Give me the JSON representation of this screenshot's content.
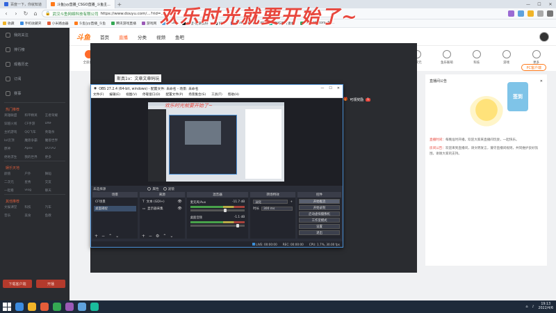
{
  "overlay_title": "欢乐时光就要开始了~",
  "browser": {
    "tabs": [
      {
        "label": "百度一下，你就知道",
        "color": "#3366dd",
        "active": false
      },
      {
        "label": "斗鱼|yy直播_CSGO直播_斗鱼主...",
        "color": "#ff7a1a",
        "active": true
      }
    ],
    "new_tab": "+",
    "url_site": "武汉斗鱼网络科技有限公司",
    "url": "https://www.douyu.com/...?rid=...",
    "bookmarks": [
      "收藏",
      "手机收藏夹",
      "小米路由器",
      "斗鱼|yy直播_斗鱼",
      "腾讯游戏直播",
      "游戏网",
      "CSGO",
      "抖音-记录美好",
      "抖音",
      "Free Transparent",
      "PNG图片素材",
      "Free Vectors, St..."
    ]
  },
  "douyu": {
    "logo": "斗鱼",
    "nav": [
      "首页",
      "直播",
      "分类",
      "视频",
      "鱼吧"
    ],
    "sidebar_top": [
      "我的关注",
      "排行榜",
      "观看历史",
      "订阅",
      "赛事"
    ],
    "sidebar_section1": "热门推荐",
    "sidebar_grid1": [
      "英雄联盟",
      "和平精英",
      "王者荣耀",
      "穿越火线",
      "CF手游",
      "DNF",
      "主机游戏",
      "QQ飞车",
      "英雄杀",
      "lol云顶",
      "魔兽争霸",
      "魔兽世界",
      "原神",
      "Apex",
      "DOTA2",
      "绝地求生",
      "我的世界",
      "更多"
    ],
    "sidebar_section2": "娱乐天地",
    "sidebar_grid2": [
      "颜值",
      "户外",
      "舞蹈",
      "二次元",
      "星秀",
      "交友",
      "一起看",
      "vlog",
      "聊天"
    ],
    "sidebar_section3": "其他推荐",
    "sidebar_grid3": [
      "文娱课堂",
      "科技",
      "汽车",
      "音乐",
      "美食",
      "鱼教"
    ],
    "sidebar_buttons": [
      "下载客户端",
      "开播"
    ],
    "categories": [
      "全部直播",
      "英雄联盟",
      "和平精英",
      "王者荣耀",
      "CF手游",
      "主机游戏",
      "DNF",
      "一起看",
      "星秀",
      "户外",
      "颜值",
      "二次元",
      "鱼乐联萌",
      "科技",
      "游戏",
      "更多"
    ],
    "pc_button": "PC客户端",
    "stream_title": "斯真1v：文章文章码玩",
    "qq_label": "可领奖励",
    "qq_badge": "1",
    "right_panel_title": "直播间公告",
    "right_panel_tab": "签到",
    "notice_1_label": "直播时间：",
    "notice_1": "每晚准时开播，欢迎大家来直播间玩耍，一起快乐。",
    "notice_2_label": "房间公告：",
    "notice_2": "欢迎来到直播间，请文明发言，遵守直播间规则，共同维护良好氛围，谢谢大家的支持。"
  },
  "obs": {
    "title": "OBS 27.2.4 (64-bit, windows) - 配置文件: 未命名 - 场景: 未命名",
    "menu": [
      "文件(F)",
      "编辑(E)",
      "视图(V)",
      "停靠窗口(D)",
      "配置文件(P)",
      "场景集合(S)",
      "工具(T)",
      "帮助(H)"
    ],
    "dock_label": "未选择源",
    "scene_btn1": "属性",
    "scene_btn2": "滤镜",
    "panel_scenes": "场景",
    "panel_sources": "来源",
    "panel_mixer": "混音器",
    "panel_transitions": "转场特效",
    "panel_controls": "控件",
    "scenes": [
      "CF场景",
      "桌面捕捉"
    ],
    "sources": [
      "文本 (GDI+)",
      "显示器采集"
    ],
    "mixer": [
      {
        "name": "麦克风/Aux",
        "db": "-11.7 dB"
      },
      {
        "name": "桌面音频",
        "db": "-1.1 dB"
      }
    ],
    "transition_type": "淡化",
    "duration_label": "时长",
    "duration_value": "300 ms",
    "controls": [
      "开始推流",
      "开始录制",
      "启动虚拟摄像机",
      "工作室模式",
      "设置",
      "退出"
    ],
    "status": {
      "live": "LIVE: 00:00:00",
      "rec": "REC: 00:00:00",
      "cpu": "CPU: 1.7%, 30.00 fps"
    }
  },
  "taskbar": {
    "time": "19:13",
    "date": "2022/4/6",
    "apps": [
      "#3b8be0",
      "#f0b429",
      "#e35d3a",
      "#34a853",
      "#9b59b6",
      "#5fa2dd",
      "#1abc9c"
    ]
  }
}
